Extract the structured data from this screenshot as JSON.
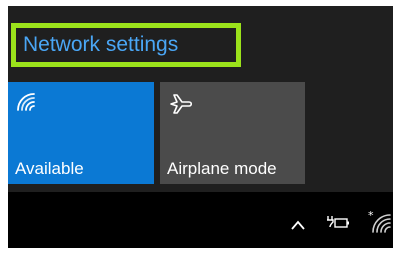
{
  "network_settings_link": {
    "label": "Network settings"
  },
  "quick_actions": [
    {
      "label": "Available",
      "icon": "wifi-icon",
      "state": "on",
      "color": "#0b79d4"
    },
    {
      "label": "Airplane mode",
      "icon": "airplane-icon",
      "state": "off",
      "color": "#4b4b4b"
    }
  ],
  "taskbar": {
    "tray_icons": [
      "chevron-up-icon",
      "battery-charging-icon",
      "wifi-icon"
    ]
  },
  "colors": {
    "link": "#4aa6f5",
    "highlight_border": "#9be21b",
    "panel_background": "#1f1f1f",
    "taskbar_background": "#000000"
  }
}
